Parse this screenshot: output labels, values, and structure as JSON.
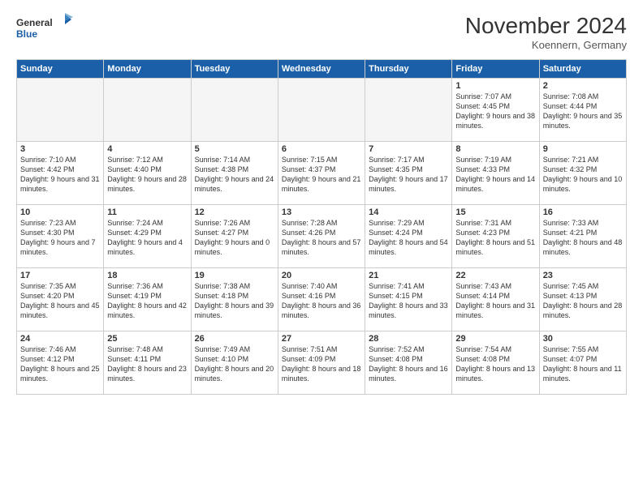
{
  "header": {
    "logo_line1": "General",
    "logo_line2": "Blue",
    "month": "November 2024",
    "location": "Koennern, Germany"
  },
  "weekdays": [
    "Sunday",
    "Monday",
    "Tuesday",
    "Wednesday",
    "Thursday",
    "Friday",
    "Saturday"
  ],
  "weeks": [
    [
      {
        "day": "",
        "info": "",
        "empty": true
      },
      {
        "day": "",
        "info": "",
        "empty": true
      },
      {
        "day": "",
        "info": "",
        "empty": true
      },
      {
        "day": "",
        "info": "",
        "empty": true
      },
      {
        "day": "",
        "info": "",
        "empty": true
      },
      {
        "day": "1",
        "info": "Sunrise: 7:07 AM\nSunset: 4:45 PM\nDaylight: 9 hours\nand 38 minutes.",
        "empty": false
      },
      {
        "day": "2",
        "info": "Sunrise: 7:08 AM\nSunset: 4:44 PM\nDaylight: 9 hours\nand 35 minutes.",
        "empty": false
      }
    ],
    [
      {
        "day": "3",
        "info": "Sunrise: 7:10 AM\nSunset: 4:42 PM\nDaylight: 9 hours\nand 31 minutes.",
        "empty": false
      },
      {
        "day": "4",
        "info": "Sunrise: 7:12 AM\nSunset: 4:40 PM\nDaylight: 9 hours\nand 28 minutes.",
        "empty": false
      },
      {
        "day": "5",
        "info": "Sunrise: 7:14 AM\nSunset: 4:38 PM\nDaylight: 9 hours\nand 24 minutes.",
        "empty": false
      },
      {
        "day": "6",
        "info": "Sunrise: 7:15 AM\nSunset: 4:37 PM\nDaylight: 9 hours\nand 21 minutes.",
        "empty": false
      },
      {
        "day": "7",
        "info": "Sunrise: 7:17 AM\nSunset: 4:35 PM\nDaylight: 9 hours\nand 17 minutes.",
        "empty": false
      },
      {
        "day": "8",
        "info": "Sunrise: 7:19 AM\nSunset: 4:33 PM\nDaylight: 9 hours\nand 14 minutes.",
        "empty": false
      },
      {
        "day": "9",
        "info": "Sunrise: 7:21 AM\nSunset: 4:32 PM\nDaylight: 9 hours\nand 10 minutes.",
        "empty": false
      }
    ],
    [
      {
        "day": "10",
        "info": "Sunrise: 7:23 AM\nSunset: 4:30 PM\nDaylight: 9 hours\nand 7 minutes.",
        "empty": false
      },
      {
        "day": "11",
        "info": "Sunrise: 7:24 AM\nSunset: 4:29 PM\nDaylight: 9 hours\nand 4 minutes.",
        "empty": false
      },
      {
        "day": "12",
        "info": "Sunrise: 7:26 AM\nSunset: 4:27 PM\nDaylight: 9 hours\nand 0 minutes.",
        "empty": false
      },
      {
        "day": "13",
        "info": "Sunrise: 7:28 AM\nSunset: 4:26 PM\nDaylight: 8 hours\nand 57 minutes.",
        "empty": false
      },
      {
        "day": "14",
        "info": "Sunrise: 7:29 AM\nSunset: 4:24 PM\nDaylight: 8 hours\nand 54 minutes.",
        "empty": false
      },
      {
        "day": "15",
        "info": "Sunrise: 7:31 AM\nSunset: 4:23 PM\nDaylight: 8 hours\nand 51 minutes.",
        "empty": false
      },
      {
        "day": "16",
        "info": "Sunrise: 7:33 AM\nSunset: 4:21 PM\nDaylight: 8 hours\nand 48 minutes.",
        "empty": false
      }
    ],
    [
      {
        "day": "17",
        "info": "Sunrise: 7:35 AM\nSunset: 4:20 PM\nDaylight: 8 hours\nand 45 minutes.",
        "empty": false
      },
      {
        "day": "18",
        "info": "Sunrise: 7:36 AM\nSunset: 4:19 PM\nDaylight: 8 hours\nand 42 minutes.",
        "empty": false
      },
      {
        "day": "19",
        "info": "Sunrise: 7:38 AM\nSunset: 4:18 PM\nDaylight: 8 hours\nand 39 minutes.",
        "empty": false
      },
      {
        "day": "20",
        "info": "Sunrise: 7:40 AM\nSunset: 4:16 PM\nDaylight: 8 hours\nand 36 minutes.",
        "empty": false
      },
      {
        "day": "21",
        "info": "Sunrise: 7:41 AM\nSunset: 4:15 PM\nDaylight: 8 hours\nand 33 minutes.",
        "empty": false
      },
      {
        "day": "22",
        "info": "Sunrise: 7:43 AM\nSunset: 4:14 PM\nDaylight: 8 hours\nand 31 minutes.",
        "empty": false
      },
      {
        "day": "23",
        "info": "Sunrise: 7:45 AM\nSunset: 4:13 PM\nDaylight: 8 hours\nand 28 minutes.",
        "empty": false
      }
    ],
    [
      {
        "day": "24",
        "info": "Sunrise: 7:46 AM\nSunset: 4:12 PM\nDaylight: 8 hours\nand 25 minutes.",
        "empty": false
      },
      {
        "day": "25",
        "info": "Sunrise: 7:48 AM\nSunset: 4:11 PM\nDaylight: 8 hours\nand 23 minutes.",
        "empty": false
      },
      {
        "day": "26",
        "info": "Sunrise: 7:49 AM\nSunset: 4:10 PM\nDaylight: 8 hours\nand 20 minutes.",
        "empty": false
      },
      {
        "day": "27",
        "info": "Sunrise: 7:51 AM\nSunset: 4:09 PM\nDaylight: 8 hours\nand 18 minutes.",
        "empty": false
      },
      {
        "day": "28",
        "info": "Sunrise: 7:52 AM\nSunset: 4:08 PM\nDaylight: 8 hours\nand 16 minutes.",
        "empty": false
      },
      {
        "day": "29",
        "info": "Sunrise: 7:54 AM\nSunset: 4:08 PM\nDaylight: 8 hours\nand 13 minutes.",
        "empty": false
      },
      {
        "day": "30",
        "info": "Sunrise: 7:55 AM\nSunset: 4:07 PM\nDaylight: 8 hours\nand 11 minutes.",
        "empty": false
      }
    ]
  ]
}
